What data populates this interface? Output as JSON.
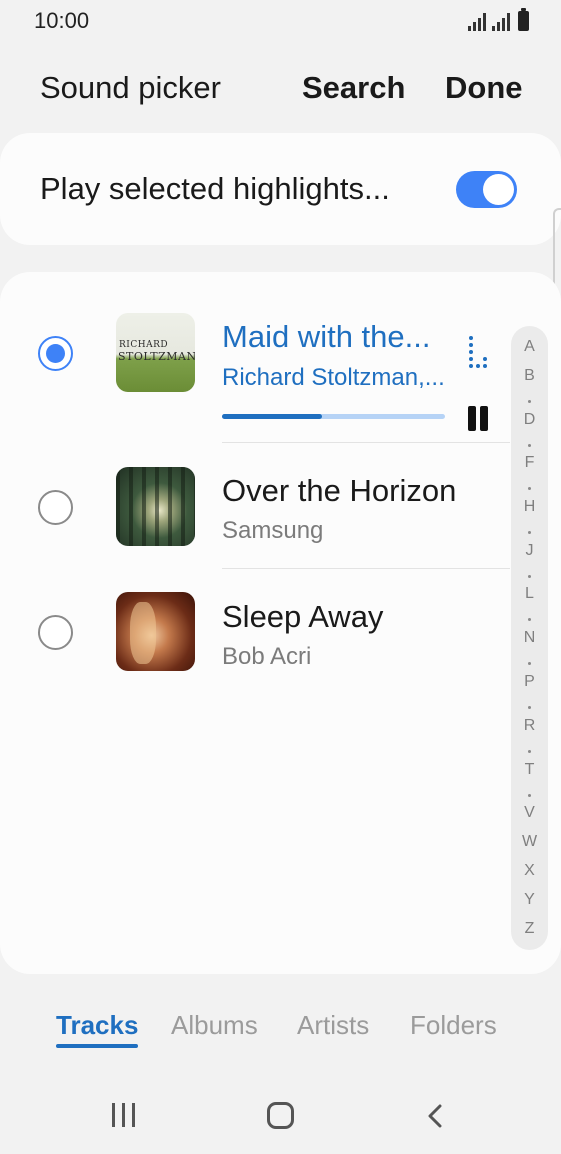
{
  "status_bar": {
    "time": "10:00",
    "icons": [
      "signal-icon",
      "signal-icon",
      "battery-icon"
    ]
  },
  "header": {
    "title": "Sound picker",
    "search_label": "Search",
    "done_label": "Done"
  },
  "highlights": {
    "label": "Play selected highlights...",
    "toggle_on": true
  },
  "tracks": [
    {
      "title": "Maid with the...",
      "artist": "Richard Stoltzman,...",
      "selected": true,
      "playing": true,
      "progress": 0.45,
      "art_text_line1": "RICHARD",
      "art_text_line2": "STOLTZMAN"
    },
    {
      "title": "Over the Horizon",
      "artist": "Samsung",
      "selected": false
    },
    {
      "title": "Sleep Away",
      "artist": "Bob Acri",
      "selected": false
    }
  ],
  "index_letters": [
    "A",
    "B",
    "D",
    "F",
    "H",
    "J",
    "L",
    "N",
    "P",
    "R",
    "T",
    "V",
    "W",
    "X",
    "Y",
    "Z"
  ],
  "tabs": [
    {
      "label": "Tracks",
      "active": true
    },
    {
      "label": "Albums",
      "active": false
    },
    {
      "label": "Artists",
      "active": false
    },
    {
      "label": "Folders",
      "active": false
    }
  ],
  "navbar": {
    "icons": [
      "recent-apps-icon",
      "home-icon",
      "back-icon"
    ]
  },
  "colors": {
    "accent": "#3e82f7",
    "selected_text": "#1f6fc0",
    "background": "#f2f2f2",
    "card": "#fcfcfc"
  }
}
